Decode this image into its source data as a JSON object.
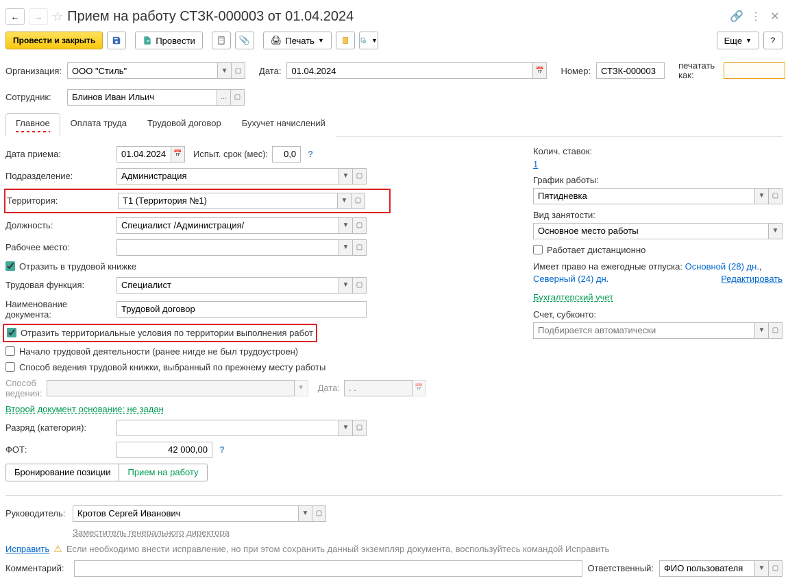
{
  "title": "Прием на работу СТЗК-000003 от 01.04.2024",
  "toolbar": {
    "save_close": "Провести и закрыть",
    "post": "Провести",
    "print": "Печать",
    "more": "Еще",
    "help": "?"
  },
  "top": {
    "org_label": "Организация:",
    "org_value": "ООО \"Стиль\"",
    "date_label": "Дата:",
    "date_value": "01.04.2024",
    "number_label": "Номер:",
    "number_value": "СТЗК-000003",
    "print_as_label": "печатать как:",
    "print_as_value": "",
    "emp_label": "Сотрудник:",
    "emp_value": "Блинов Иван Ильич"
  },
  "tabs": [
    "Главное",
    "Оплата труда",
    "Трудовой договор",
    "Бухучет начислений"
  ],
  "main": {
    "hire_date_label": "Дата приема:",
    "hire_date": "01.04.2024",
    "trial_label": "Испыт. срок (мес):",
    "trial_value": "0,0",
    "dept_label": "Подразделение:",
    "dept_value": "Администрация",
    "territory_label": "Территория:",
    "territory_value": "Т1 (Территория №1)",
    "position_label": "Должность:",
    "position_value": "Специалист /Администрация/",
    "workplace_label": "Рабочее место:",
    "workplace_value": "",
    "reflect_workbook": "Отразить в трудовой книжке",
    "labor_func_label": "Трудовая функция:",
    "labor_func_value": "Специалист",
    "doc_name_label": "Наименование документа:",
    "doc_name_value": "Трудовой договор",
    "reflect_territory": "Отразить территориальные условия по территории выполнения работ",
    "first_job": "Начало трудовой деятельности (ранее нигде не был трудоустроен)",
    "prev_workbook": "Способ ведения трудовой книжки, выбранный по прежнему месту работы",
    "method_label": "Способ ведения:",
    "date2_label": "Дата:",
    "date2_placeholder": ". .",
    "second_doc": "Второй документ основание: не задан",
    "rank_label": "Разряд (категория):",
    "fot_label": "ФОТ:",
    "fot_value": "42 000,00",
    "toggle_booking": "Бронирование позиции",
    "toggle_hire": "Прием на работу"
  },
  "right": {
    "stakes_label": "Колич. ставок:",
    "stakes_value": "1",
    "schedule_label": "График работы:",
    "schedule_value": "Пятидневка",
    "emp_type_label": "Вид занятости:",
    "emp_type_value": "Основное место работы",
    "remote": "Работает дистанционно",
    "vacation_text": "Имеет право на ежегодные отпуска: ",
    "vacation_main": "Основной (28) дн.",
    "vacation_sep": ", ",
    "vacation_north": "Северный (24) дн.",
    "edit": "Редактировать",
    "accounting": "Бухгалтерский учет",
    "account_label": "Счет, субконто:",
    "account_placeholder": "Подбирается автоматически"
  },
  "footer": {
    "manager_label": "Руководитель:",
    "manager_value": "Кротов Сергей Иванович",
    "manager_pos": "Заместитель генерального директора",
    "fix": "Исправить",
    "fix_text": "Если необходимо внести исправление, но при этом сохранить данный экземпляр документа, воспользуйтесь командой Исправить",
    "comment_label": "Комментарий:",
    "resp_label": "Ответственный:",
    "resp_value": "ФИО пользователя"
  }
}
